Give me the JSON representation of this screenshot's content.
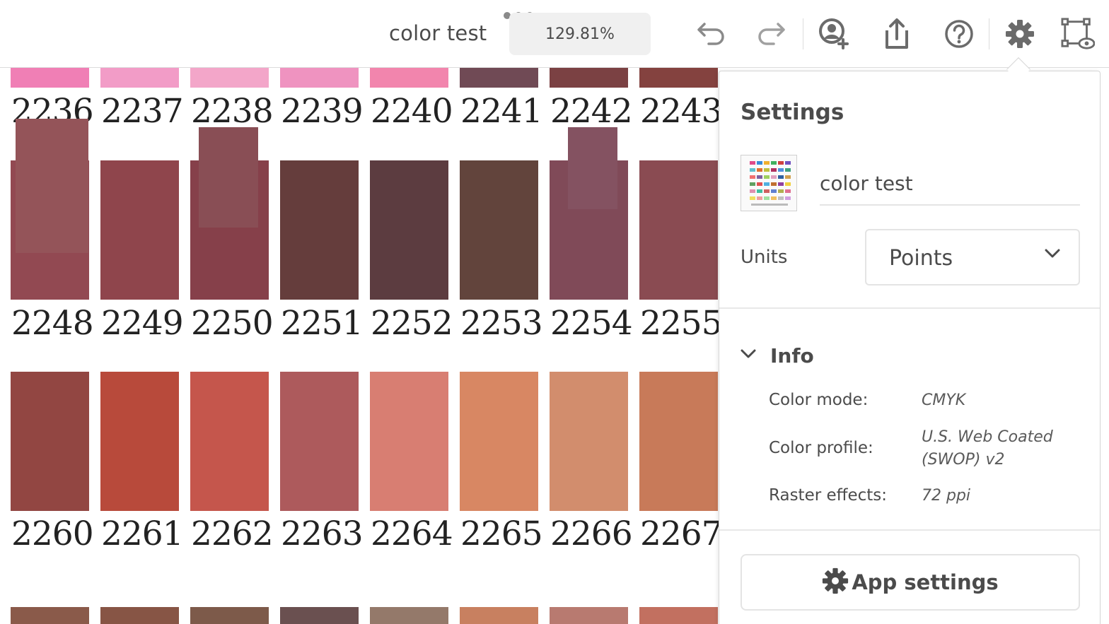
{
  "document": {
    "title": "color test"
  },
  "toolbar": {
    "zoom": "129.81%",
    "icons": [
      "more-icon",
      "undo-icon",
      "redo-icon",
      "invite-person-icon",
      "share-icon",
      "help-icon",
      "settings-gear-icon",
      "artboard-view-icon"
    ]
  },
  "swatches": {
    "rows": [
      {
        "numbers": [
          "2236",
          "2237",
          "2238",
          "2239",
          "2240",
          "2241",
          "2242",
          "2243"
        ],
        "colors": [
          "#f07fb5",
          "#f29cc7",
          "#f3a6c9",
          "#ef93c0",
          "#f285ad",
          "#704a55",
          "#7b4143",
          "#84423f"
        ],
        "hidden_colors": [
          "#8a3e3f",
          "#8c3a44",
          "#8a3d48"
        ]
      },
      {
        "numbers": [
          "2248",
          "2249",
          "2250",
          "2251",
          "2252",
          "2253",
          "2254",
          "2255"
        ],
        "colors": [
          "#924952",
          "#8f454c",
          "#86404a",
          "#653d3c",
          "#5c3c40",
          "#62443c",
          "#804a58",
          "#8a4b52"
        ],
        "overlay_colors": [
          "#945459",
          "#894e55",
          "#845261"
        ]
      },
      {
        "numbers": [
          "2260",
          "2261",
          "2262",
          "2263",
          "2264",
          "2265",
          "2266",
          "2267"
        ],
        "colors": [
          "#924642",
          "#b84a3b",
          "#c5564c",
          "#ad5a5c",
          "#d87e72",
          "#d88763",
          "#d28d6d",
          "#c87a59"
        ]
      },
      {
        "numbers": [],
        "colors": [
          "#8a5a4a",
          "#875545",
          "#7d5a4a",
          "#6a5050",
          "#94796a",
          "#c88060",
          "#b87a70",
          "#c27060"
        ]
      }
    ]
  },
  "settings_panel": {
    "title": "Settings",
    "document_name": "color test",
    "units_label": "Units",
    "units_value": "Points",
    "info_section": "Info",
    "info": [
      {
        "label": "Color mode:",
        "value": "CMYK"
      },
      {
        "label": "Color profile:",
        "value": "U.S. Web Coated (SWOP) v2"
      },
      {
        "label": "Raster effects:",
        "value": "72 ppi"
      }
    ],
    "app_settings_button": "App settings"
  },
  "colors": {
    "icon_gray": "#6b6b6b",
    "border": "#e4e4e4",
    "text": "#4b4b4b"
  }
}
